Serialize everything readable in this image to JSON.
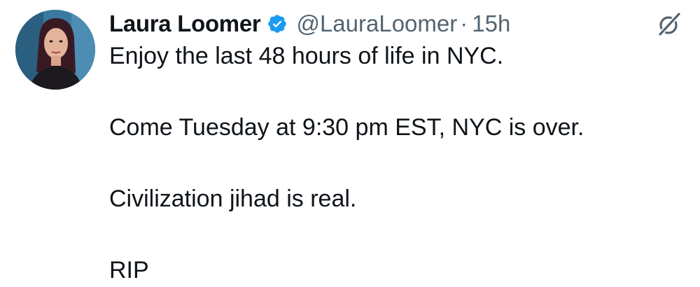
{
  "tweet": {
    "author": {
      "display_name": "Laura Loomer",
      "handle": "@LauraLoomer",
      "verified_icon": "verified-badge-icon",
      "avatar_icon": "profile-photo"
    },
    "separator": "·",
    "time": "15h",
    "grok_icon": "grok-icon",
    "text_lines": [
      "Enjoy the last 48 hours of life in NYC.",
      "Come Tuesday at 9:30 pm EST, NYC is over.",
      "Civilization jihad is real.",
      "RIP"
    ]
  },
  "colors": {
    "text_primary": "#0f1419",
    "text_secondary": "#536471",
    "verified_blue": "#1d9bf0",
    "background": "#ffffff"
  }
}
